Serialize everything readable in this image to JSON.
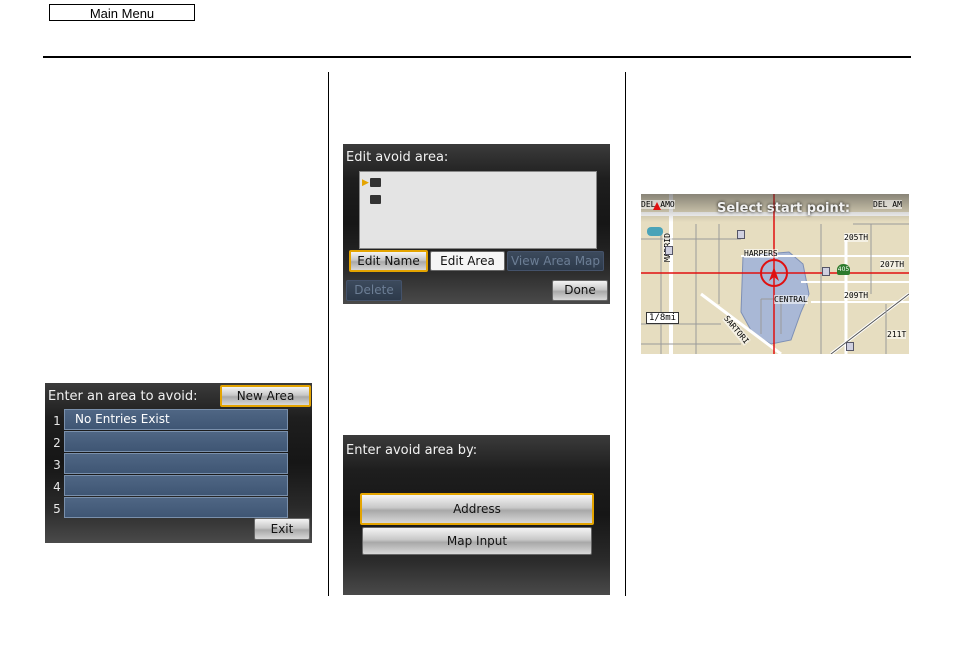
{
  "header": {
    "main_menu_label": "Main Menu"
  },
  "list_screen": {
    "title": "Enter an area to avoid:",
    "new_area_label": "New Area",
    "rows": [
      {
        "num": "1",
        "label": "No Entries Exist"
      },
      {
        "num": "2",
        "label": ""
      },
      {
        "num": "3",
        "label": ""
      },
      {
        "num": "4",
        "label": ""
      },
      {
        "num": "5",
        "label": ""
      }
    ],
    "exit_label": "Exit"
  },
  "edit_screen": {
    "title": "Edit avoid area:",
    "buttons": {
      "edit_name": "Edit Name",
      "edit_area": "Edit Area",
      "view_area_map": "View Area Map",
      "delete": "Delete",
      "done": "Done"
    }
  },
  "enter_by_screen": {
    "title": "Enter avoid area by:",
    "address_label": "Address",
    "map_input_label": "Map Input"
  },
  "map_screen": {
    "title": "Select start point:",
    "roads": {
      "del_amo_left": "DEL AMO",
      "del_amo_right": "DEL AM",
      "harpers": "HARPERS",
      "central": "CENTRAL",
      "th205": "205TH",
      "th207": "207TH",
      "th209": "209TH",
      "th211": "211T",
      "madrid": "MADRID",
      "sartori": "SARTORI"
    },
    "scale": "1/8mi",
    "route_shield": "405",
    "colors": {
      "crosshair": "#e01010",
      "water": "#a9b8d6",
      "land": "#e6ddc0",
      "road": "#ffffff"
    }
  }
}
